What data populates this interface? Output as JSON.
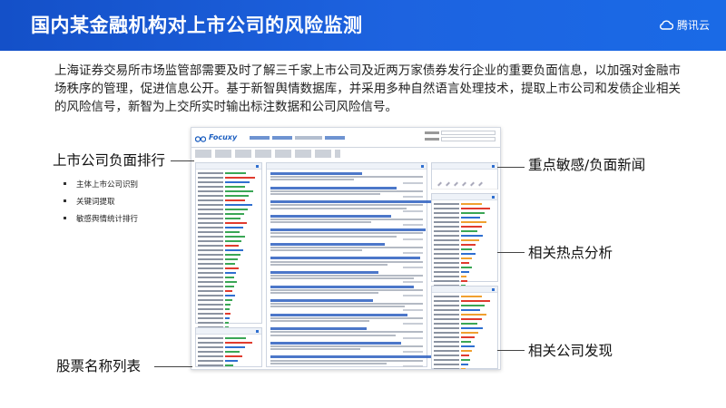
{
  "slide": {
    "title": "国内某金融机构对上市公司的风险监测",
    "brand": {
      "name": "腾讯云",
      "icon": "cloud-icon"
    },
    "intro": "上海证券交易所市场监管部需要及时了解三千家上市公司及近两万家债券发行企业的重要负面信息，以加强对金融市场秩序的管理，促进信息公开。基于新智舆情数据库，并采用多种自然语言处理技术，提取上市公司和发债企业相关的风险信号，新智为上交所实时输出标注数据和公司风险信号。"
  },
  "screenshot": {
    "logo_text": "Focuxy",
    "logo_icon": "binoculars-icon"
  },
  "annotations": {
    "left_top": "上市公司负面排行",
    "bullets": [
      "主体上市公司识别",
      "关键词提取",
      "敏感舆情统计排行"
    ],
    "left_bottom": "股票名称列表",
    "right_1": "重点敏感/负面新闻",
    "right_2": "相关热点分析",
    "right_3": "相关公司发现"
  },
  "colors": {
    "header": "#1a5fd8",
    "accent_green": "#3aa655",
    "accent_red": "#e03b2e",
    "accent_blue": "#2f6fd0",
    "accent_orange": "#f0a030"
  }
}
